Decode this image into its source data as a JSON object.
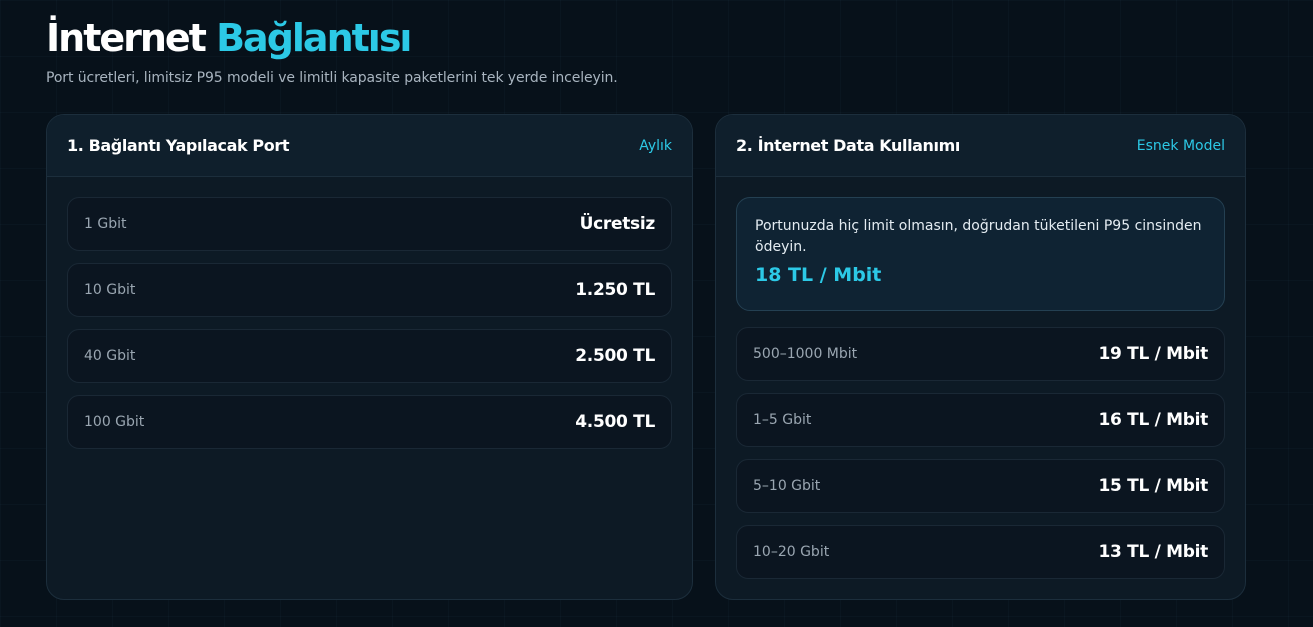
{
  "header": {
    "title_main": "İnternet",
    "title_accent": "Bağlantısı",
    "subtitle": "Port ücretleri, limitsiz P95 modeli ve limitli kapasite paketlerini tek yerde inceleyin."
  },
  "port_panel": {
    "title": "1. Bağlantı Yapılacak Port",
    "tag": "Aylık",
    "rows": [
      {
        "label": "1 Gbit",
        "value": "Ücretsiz"
      },
      {
        "label": "10 Gbit",
        "value": "1.250 TL"
      },
      {
        "label": "40 Gbit",
        "value": "2.500 TL"
      },
      {
        "label": "100 Gbit",
        "value": "4.500 TL"
      }
    ]
  },
  "data_panel": {
    "title": "2. İnternet Data Kullanımı",
    "tag": "Esnek Model",
    "highlight": {
      "text": "Portunuzda hiç limit olmasın, doğrudan tüketileni P95 cinsinden ödeyin.",
      "price": "18 TL / Mbit"
    },
    "rows": [
      {
        "label": "500–1000 Mbit",
        "value": "19 TL / Mbit"
      },
      {
        "label": "1–5 Gbit",
        "value": "16 TL / Mbit"
      },
      {
        "label": "5–10 Gbit",
        "value": "15 TL / Mbit"
      },
      {
        "label": "10–20 Gbit",
        "value": "13 TL / Mbit"
      }
    ]
  },
  "colors": {
    "accent": "#2cc9e6",
    "background": "#07111a",
    "panel": "#0d1a25"
  }
}
